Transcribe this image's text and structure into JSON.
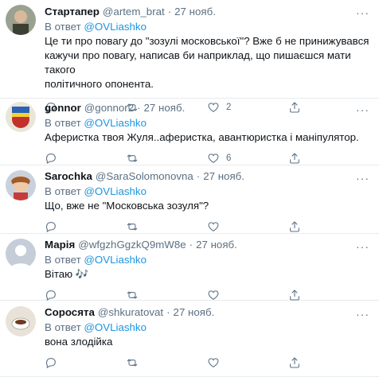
{
  "reply_prefix": "В ответ",
  "tweets": [
    {
      "name": "Стартапер",
      "handle": "@artem_brat",
      "time": "27 нояб.",
      "reply_to": "@OVLiashko",
      "text_lines": [
        "Це ти про повагу до \"зозулі московської\"? Вже б не принижувався",
        "кажучи про повагу, написав би наприклад, що пишаєшся мати такого",
        "політичного опонента."
      ],
      "likes": "2",
      "avatar_color": "#9aa191"
    },
    {
      "name": "gonnor",
      "handle": "@gonnor2",
      "time": "27 нояб.",
      "reply_to": "@OVLiashko",
      "text_lines": [
        "Аферистка твоя Жуля..аферистка, авантюристка і маніпулятор."
      ],
      "likes": "6",
      "avatar_color": "#d8d25a"
    },
    {
      "name": "Sarochka",
      "handle": "@SaraSolomonovna",
      "time": "27 нояб.",
      "reply_to": "@OVLiashko",
      "text_lines": [
        "Що, вже не \"Московська зозуля\"?"
      ],
      "likes": "",
      "avatar_color": "#c98a5e"
    },
    {
      "name": "Марія",
      "handle": "@wfgzhGgzkQ9mW8e",
      "time": "27 нояб.",
      "reply_to": "@OVLiashko",
      "text_lines": [
        "Вітаю 🎶"
      ],
      "likes": "",
      "avatar_color": "#c5ced8"
    },
    {
      "name": "Соросята",
      "handle": "@shkuratovat",
      "time": "27 нояб.",
      "reply_to": "@OVLiashko",
      "text_lines": [
        "вона злодійка"
      ],
      "likes": "",
      "avatar_color": "#e8e2d8"
    }
  ]
}
